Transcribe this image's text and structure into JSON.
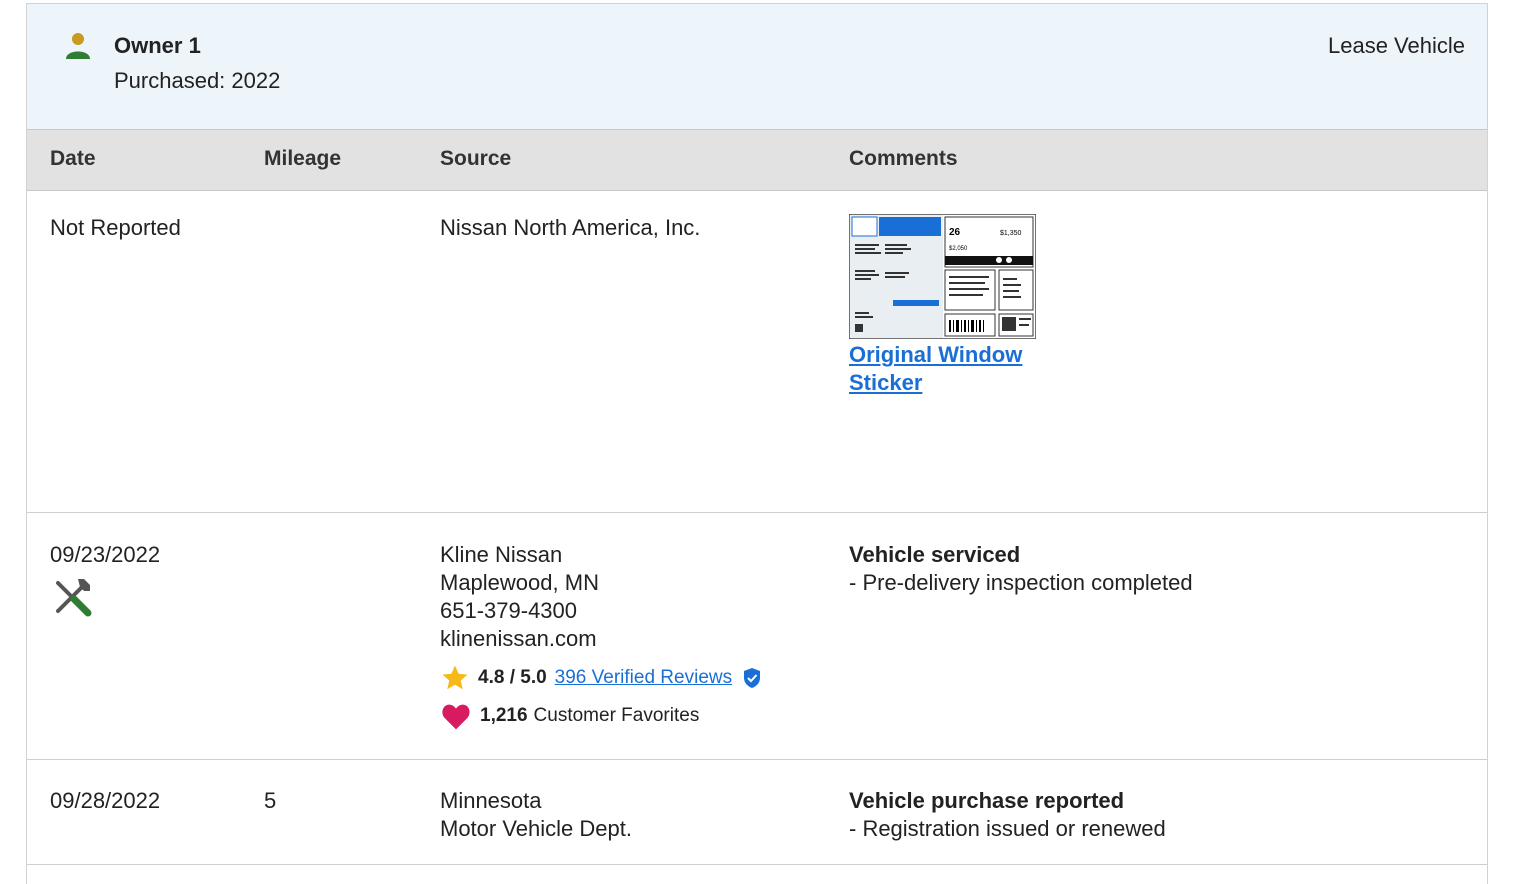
{
  "owner": {
    "title": "Owner 1",
    "purchased": "Purchased: 2022",
    "lease_label": "Lease Vehicle"
  },
  "table": {
    "headers": {
      "date": "Date",
      "mileage": "Mileage",
      "source": "Source",
      "comments": "Comments"
    },
    "rows": [
      {
        "date": "Not Reported",
        "mileage": "",
        "source_lines": [
          "Nissan North America, Inc."
        ],
        "comment_link": "Original Window Sticker",
        "sticker": {
          "mpg": "26",
          "price": "$1,350",
          "cost": "$2,050"
        }
      },
      {
        "date": "09/23/2022",
        "mileage": "",
        "icon": "service-wrench-screwdriver-icon",
        "source_lines": [
          "Kline Nissan",
          "Maplewood, MN",
          "651-379-4300",
          "klinenissan.com"
        ],
        "rating": "4.8 / 5.0",
        "reviews_link": "396 Verified Reviews",
        "favorites_count": "1,216",
        "favorites_label": "Customer Favorites",
        "comment_title": "Vehicle serviced",
        "comment_detail": "- Pre-delivery inspection completed"
      },
      {
        "date": "09/28/2022",
        "mileage": "5",
        "source_lines": [
          "Minnesota",
          "Motor Vehicle Dept."
        ],
        "comment_title": "Vehicle purchase reported",
        "comment_detail": "- Registration issued or renewed"
      }
    ]
  },
  "colors": {
    "header_bg": "#edf4fa",
    "table_header_bg": "#e2e2e2",
    "link": "#1a6fd6",
    "person_icon": "#2e7d32",
    "star": "#f6b91a",
    "heart": "#d81b60",
    "verified": "#1a6fd6"
  }
}
